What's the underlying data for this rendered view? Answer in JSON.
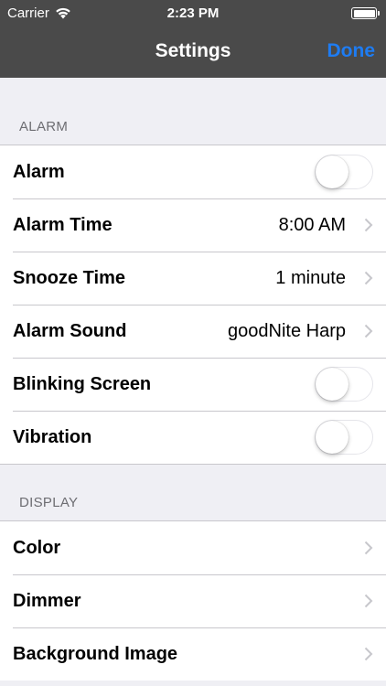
{
  "status_bar": {
    "carrier": "Carrier",
    "time": "2:23 PM"
  },
  "nav": {
    "title": "Settings",
    "done_label": "Done"
  },
  "colors": {
    "accent": "#1e7cf2",
    "bar": "#4a4a4a",
    "background": "#efeff4"
  },
  "sections": {
    "alarm": {
      "header": "ALARM",
      "rows": [
        {
          "label": "Alarm",
          "type": "toggle",
          "on": false
        },
        {
          "label": "Alarm Time",
          "value": "8:00 AM",
          "type": "disclosure"
        },
        {
          "label": "Snooze Time",
          "value": "1 minute",
          "type": "disclosure"
        },
        {
          "label": "Alarm Sound",
          "value": "goodNite Harp",
          "type": "disclosure"
        },
        {
          "label": "Blinking Screen",
          "type": "toggle",
          "on": false
        },
        {
          "label": "Vibration",
          "type": "toggle",
          "on": false
        }
      ]
    },
    "display": {
      "header": "DISPLAY",
      "rows": [
        {
          "label": "Color",
          "type": "disclosure"
        },
        {
          "label": "Dimmer",
          "type": "disclosure"
        },
        {
          "label": "Background Image",
          "type": "disclosure"
        }
      ]
    }
  }
}
